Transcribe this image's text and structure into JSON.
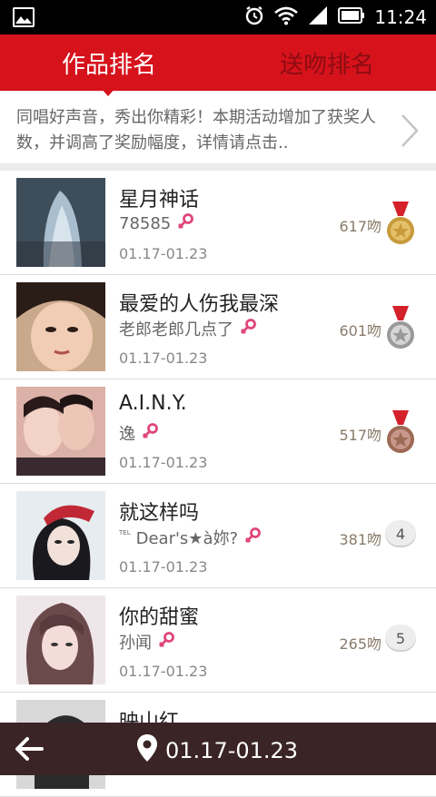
{
  "statusbar": {
    "time": "11:24"
  },
  "tabs": {
    "works": "作品排名",
    "kisses": "送吻排名"
  },
  "banner": {
    "text": "同唱好声音，秀出你精彩！本期活动增加了获奖人数，并调高了奖励幅度，详情请点击.."
  },
  "rows": [
    {
      "title": "星月神话",
      "user": "78585",
      "prefix": "",
      "date": "01.17-01.23",
      "votes": "617吻",
      "medal": "gold"
    },
    {
      "title": "最爱的人伤我最深",
      "user": "老郎老郎几点了",
      "prefix": "",
      "date": "01.17-01.23",
      "votes": "601吻",
      "medal": "silver"
    },
    {
      "title": "A.I.N.Y.",
      "user": "逸",
      "prefix": "",
      "date": "01.17-01.23",
      "votes": "517吻",
      "medal": "bronze"
    },
    {
      "title": "就这样吗",
      "user": "Dear's★à妳?",
      "prefix": "TEL",
      "date": "01.17-01.23",
      "votes": "381吻",
      "rank": "4"
    },
    {
      "title": "你的甜蜜",
      "user": "孙闻",
      "prefix": "",
      "date": "01.17-01.23",
      "votes": "265吻",
      "rank": "5"
    },
    {
      "title": "映山红",
      "user": "",
      "prefix": "",
      "date": "",
      "votes": ""
    }
  ],
  "bottom": {
    "period": "01.17-01.23"
  },
  "colors": {
    "accent": "#d6121b",
    "bottom_bar": "#3a2426",
    "female_icon": "#e0457b"
  }
}
